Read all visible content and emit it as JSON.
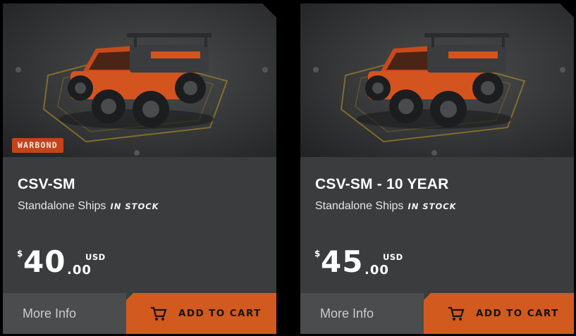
{
  "cards": [
    {
      "badge": "WARBOND",
      "name": "CSV-SM",
      "category": "Standalone Ships",
      "stock": "IN STOCK",
      "price": {
        "currency_symbol": "$",
        "whole": "40",
        "cents": ".00",
        "currency": "USD"
      },
      "more_info_label": "More Info",
      "add_to_cart_label": "ADD TO CART",
      "cart_icon": "cart-icon"
    },
    {
      "name": "CSV-SM - 10 YEAR",
      "category": "Standalone Ships",
      "stock": "IN STOCK",
      "price": {
        "currency_symbol": "$",
        "whole": "45",
        "cents": ".00",
        "currency": "USD"
      },
      "more_info_label": "More Info",
      "add_to_cart_label": "ADD TO CART",
      "cart_icon": "cart-icon"
    }
  ],
  "colors": {
    "card_bg": "#3a3c3d",
    "accent_orange": "#d25a1f",
    "badge_bg": "#c2441b",
    "more_info_bg": "#4a4c4e"
  }
}
